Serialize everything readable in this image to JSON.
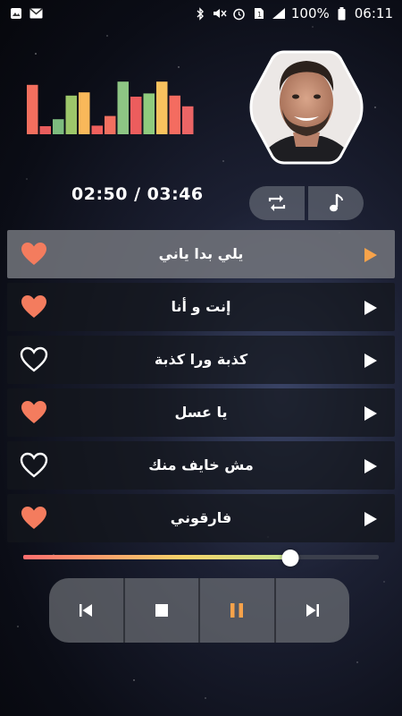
{
  "statusbar": {
    "battery_text": "100%",
    "clock": "06:11"
  },
  "player": {
    "time_display": "02:50 / 03:46",
    "progress": 0.75,
    "state": "playing"
  },
  "colors": {
    "accent": "#f8a34a",
    "heart": "#f47c5e",
    "equalizer": [
      "#f36f5e",
      "#e85d5d",
      "#7dbb7e",
      "#9cc66a",
      "#f9b85a",
      "#f0605d",
      "#f17060",
      "#8dc584",
      "#ec5d5d",
      "#8fcb7e",
      "#f8c25e",
      "#f46c60",
      "#ec6565"
    ]
  },
  "equalizer_levels": [
    0.92,
    0.15,
    0.28,
    0.72,
    0.78,
    0.16,
    0.34,
    0.98,
    0.7,
    0.76,
    0.98,
    0.72,
    0.52
  ],
  "playlist": [
    {
      "title": "يلي بدا ياني",
      "liked": true,
      "active": true
    },
    {
      "title": "إنت و أنا",
      "liked": true,
      "active": false
    },
    {
      "title": "كذبة ورا كذبة",
      "liked": false,
      "active": false
    },
    {
      "title": "يا عسل",
      "liked": true,
      "active": false
    },
    {
      "title": "مش خايف منك",
      "liked": false,
      "active": false
    },
    {
      "title": "فارقوني",
      "liked": true,
      "active": false
    }
  ]
}
